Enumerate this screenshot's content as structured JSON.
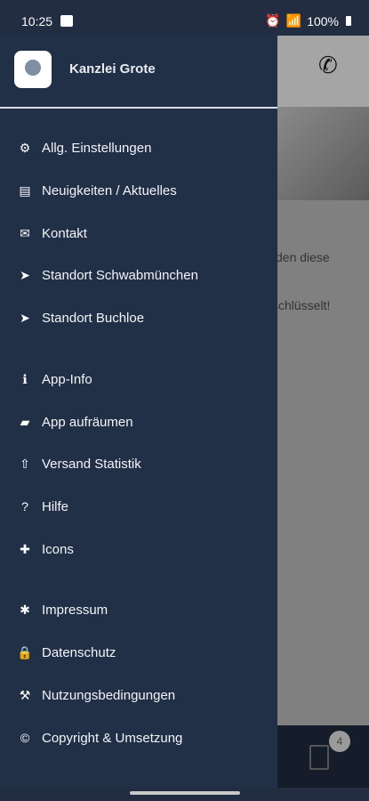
{
  "status": {
    "time": "10:25",
    "battery": "100%"
  },
  "drawer": {
    "title": "Kanzlei Grote",
    "menu": [
      {
        "label": "Allg. Einstellungen",
        "icon": "gear-icon"
      },
      {
        "label": "Neuigkeiten / Aktuelles",
        "icon": "newspaper-icon"
      },
      {
        "label": "Kontakt",
        "icon": "mail-icon"
      },
      {
        "label": "Standort Schwabmünchen",
        "icon": "location-arrow-icon"
      },
      {
        "label": "Standort Buchloe",
        "icon": "location-arrow-icon"
      },
      {
        "label": "App-Info",
        "icon": "info-icon"
      },
      {
        "label": "App aufräumen",
        "icon": "eraser-icon"
      },
      {
        "label": "Versand Statistik",
        "icon": "upload-icon"
      },
      {
        "label": "Hilfe",
        "icon": "question-icon"
      },
      {
        "label": "Icons",
        "icon": "icons-icon"
      },
      {
        "label": "Impressum",
        "icon": "asterisk-icon"
      },
      {
        "label": "Datenschutz",
        "icon": "lock-icon"
      },
      {
        "label": "Nutzungsbedingungen",
        "icon": "gavel-icon"
      },
      {
        "label": "Copyright & Umsetzung",
        "icon": "copyright-icon"
      }
    ]
  },
  "background": {
    "text1": "den diese",
    "text2": "schlüsselt!",
    "badge": "4"
  }
}
